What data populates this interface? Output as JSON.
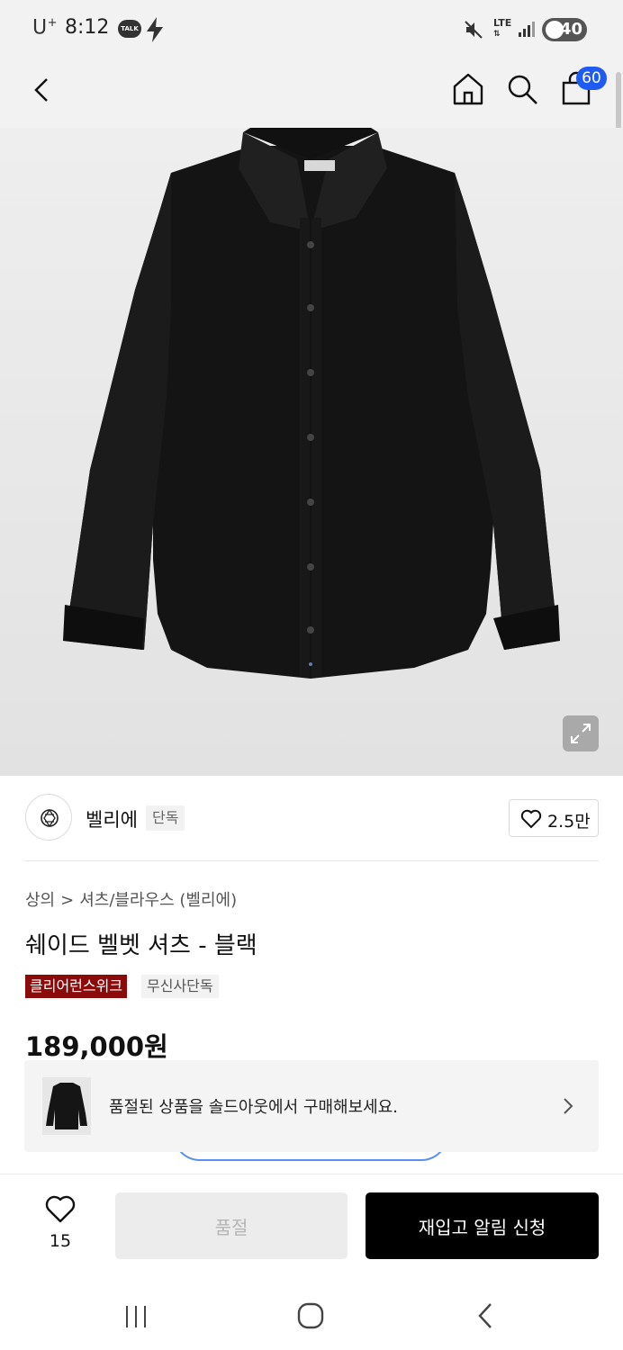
{
  "status_bar": {
    "carrier": "U",
    "carrier_sup": "+",
    "time": "8:12",
    "talk_badge": "TALK",
    "network": "LTE",
    "battery": "40"
  },
  "header": {
    "cart_count": "60"
  },
  "product": {
    "brand_name": "벨리에",
    "brand_tag": "단독",
    "likes": "2.5만",
    "breadcrumb": [
      "상의",
      "셔츠/블라우스 (벨리에)"
    ],
    "breadcrumb_sep": ">",
    "title": "쉐이드 벨벳 셔츠 - 블랙",
    "badges": [
      "클리어런스위크",
      "무신사단독"
    ],
    "price": "189,000원"
  },
  "soldout_banner": {
    "text": "품절된 상품을 솔드아웃에서 구매해보세요."
  },
  "bottom_bar": {
    "wish_count": "15",
    "soldout_label": "품절",
    "restock_label": "재입고 알림 신청"
  },
  "colors": {
    "accent": "#1e5bf0",
    "badge_red": "#8b0a0a",
    "primary_button": "#000000",
    "disabled_button": "#ececec"
  },
  "icons": [
    "back-icon",
    "home-icon",
    "search-icon",
    "cart-icon",
    "expand-icon",
    "heart-icon",
    "chevron-right-icon",
    "recent-apps-icon",
    "home-button-icon",
    "nav-back-icon"
  ]
}
